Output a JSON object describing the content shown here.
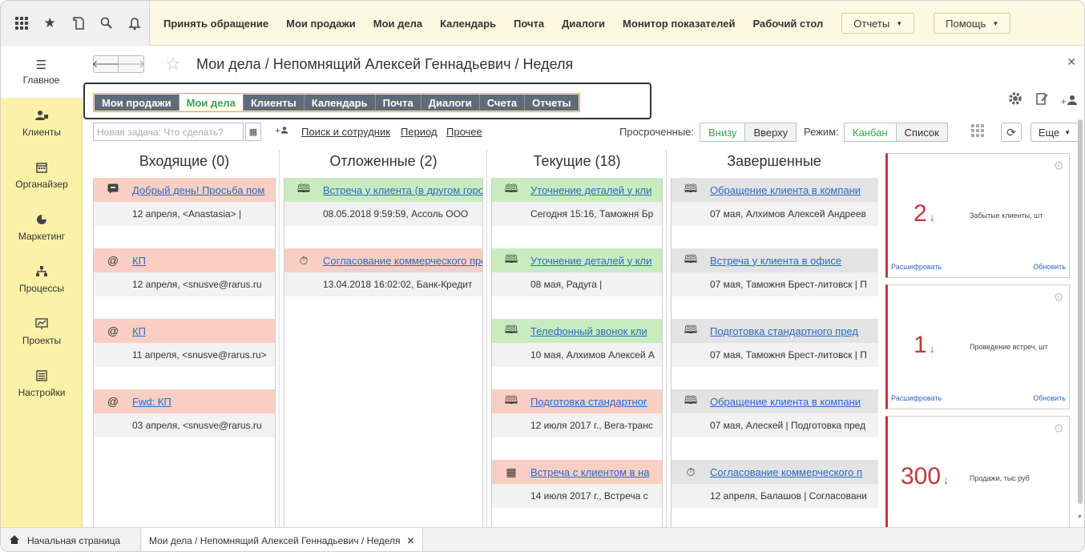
{
  "top_icons": [
    "apps-grid-icon",
    "star-icon",
    "history-icon",
    "search-icon",
    "bell-icon"
  ],
  "top_menu": [
    "Принять обращение",
    "Мои продажи",
    "Мои дела",
    "Календарь",
    "Почта",
    "Диалоги",
    "Монитор показателей",
    "Рабочий стол"
  ],
  "top_buttons": {
    "reports": "Отчеты",
    "help": "Помощь"
  },
  "sidebar": [
    {
      "label": "Главное",
      "icon": "menu-icon"
    },
    {
      "label": "Клиенты",
      "icon": "clients-icon"
    },
    {
      "label": "Органайзер",
      "icon": "calendar-icon"
    },
    {
      "label": "Маркетинг",
      "icon": "pie-icon"
    },
    {
      "label": "Процессы",
      "icon": "process-icon"
    },
    {
      "label": "Проекты",
      "icon": "chart-icon"
    },
    {
      "label": "Настройки",
      "icon": "settings-icon"
    }
  ],
  "page_title": "Мои дела / Непомнящий Алексей Геннадьевич / Неделя",
  "tabs": [
    {
      "label": "Мои продажи",
      "active": false
    },
    {
      "label": "Мои дела",
      "active": true
    },
    {
      "label": "Клиенты",
      "active": false
    },
    {
      "label": "Календарь",
      "active": false
    },
    {
      "label": "Почта",
      "active": false
    },
    {
      "label": "Диалоги",
      "active": false
    },
    {
      "label": "Счета",
      "active": false
    },
    {
      "label": "Отчеты",
      "active": false
    }
  ],
  "toolbar": {
    "task_placeholder": "Новая задача: Что сделать?",
    "search_link": "Поиск и сотрудник",
    "period_link": "Период",
    "other_link": "Прочее",
    "overdue_label": "Просроченные:",
    "overdue_bottom": "Внизу",
    "overdue_top": "Вверху",
    "mode_label": "Режим:",
    "mode_kanban": "Канбан",
    "mode_list": "Список",
    "more": "Еще"
  },
  "columns": [
    {
      "title": "Входящие (0)",
      "cards": [
        {
          "icon": "chat-icon",
          "color": "red",
          "title": "Добрый день! Просьба пом",
          "sub": "12 апреля,  <Anastasia> |"
        },
        {
          "icon": "at-icon",
          "color": "red",
          "title": "КП",
          "sub": "12 апреля,  <snusve@rarus.ru"
        },
        {
          "icon": "at-icon",
          "color": "red",
          "title": "КП",
          "sub": "11 апреля,  <snusve@rarus.ru>"
        },
        {
          "icon": "at-icon",
          "color": "red",
          "title": "Fwd: КП",
          "sub": "03 апреля,  <snusve@rarus.ru"
        }
      ]
    },
    {
      "title": "Отложенные (2)",
      "cards": [
        {
          "icon": "book-icon",
          "color": "green",
          "title": "Встреча у клиента (в другом горо",
          "sub": "08.05.2018 9:59:59, Ассоль ООО"
        },
        {
          "icon": "timer-icon",
          "color": "red",
          "title": "Согласование коммерческого пре",
          "sub": "13.04.2018 16:02:02, Банк-Кредит"
        }
      ]
    },
    {
      "title": "Текущие (18)",
      "cards": [
        {
          "icon": "book-icon",
          "color": "green",
          "title": "Уточнение деталей у кли",
          "sub": "Сегодня 15:16, Таможня Бр"
        },
        {
          "icon": "book-icon",
          "color": "green",
          "title": "Уточнение деталей у кли",
          "sub": "08 мая, Радуга |"
        },
        {
          "icon": "book-icon",
          "color": "green",
          "title": "Телефонный звонок кли",
          "sub": "10 мая, Алхимов Алексей А"
        },
        {
          "icon": "book-icon",
          "color": "red",
          "title": "Подготовка стандартног",
          "sub": "12 июля 2017 г., Вега-транс"
        },
        {
          "icon": "calendar-icon",
          "color": "red",
          "title": "Встреча с клиентом в на",
          "sub": "14 июля 2017 г., Встреча с"
        }
      ]
    },
    {
      "title": "Завершенные",
      "cards": [
        {
          "icon": "book-icon",
          "color": "gray",
          "title": "Обращение клиента в компани",
          "sub": "07 мая, Алхимов Алексей Андреев"
        },
        {
          "icon": "book-icon",
          "color": "gray",
          "title": "Встреча у клиента в офисе",
          "sub": "07 мая, Таможня Брест-литовск | П"
        },
        {
          "icon": "book-icon",
          "color": "gray",
          "title": "Подготовка стандартного пред",
          "sub": "07 мая, Таможня Брест-литовск | П"
        },
        {
          "icon": "book-icon",
          "color": "gray",
          "title": "Обращение клиента в компани",
          "sub": "07 мая, Алескей | Подготовка пред"
        },
        {
          "icon": "timer-icon",
          "color": "gray",
          "title": "Согласование коммерческого п",
          "sub": "12 апреля, Балашов | Согласовани"
        }
      ]
    }
  ],
  "widgets": [
    {
      "value": "2",
      "caption": "Забытые клиенты, шт",
      "decode": "Расшифровать",
      "refresh": "Обновить"
    },
    {
      "value": "1",
      "caption": "Проведение встреч, шт",
      "decode": "Расшифровать",
      "refresh": "Обновить"
    },
    {
      "value": "300",
      "caption": "Продажи, тыс руб",
      "decode": "",
      "refresh": ""
    }
  ],
  "bottom_tabs": {
    "home": "Начальная страница",
    "current": "Мои дела / Непомнящий Алексей Геннадьевич / Неделя"
  },
  "colors": {
    "accent_green": "#3aa54a",
    "alert_red": "#c0393b",
    "link_blue": "#2b6ac4",
    "sidebar_yellow": "#fbf2a8"
  }
}
